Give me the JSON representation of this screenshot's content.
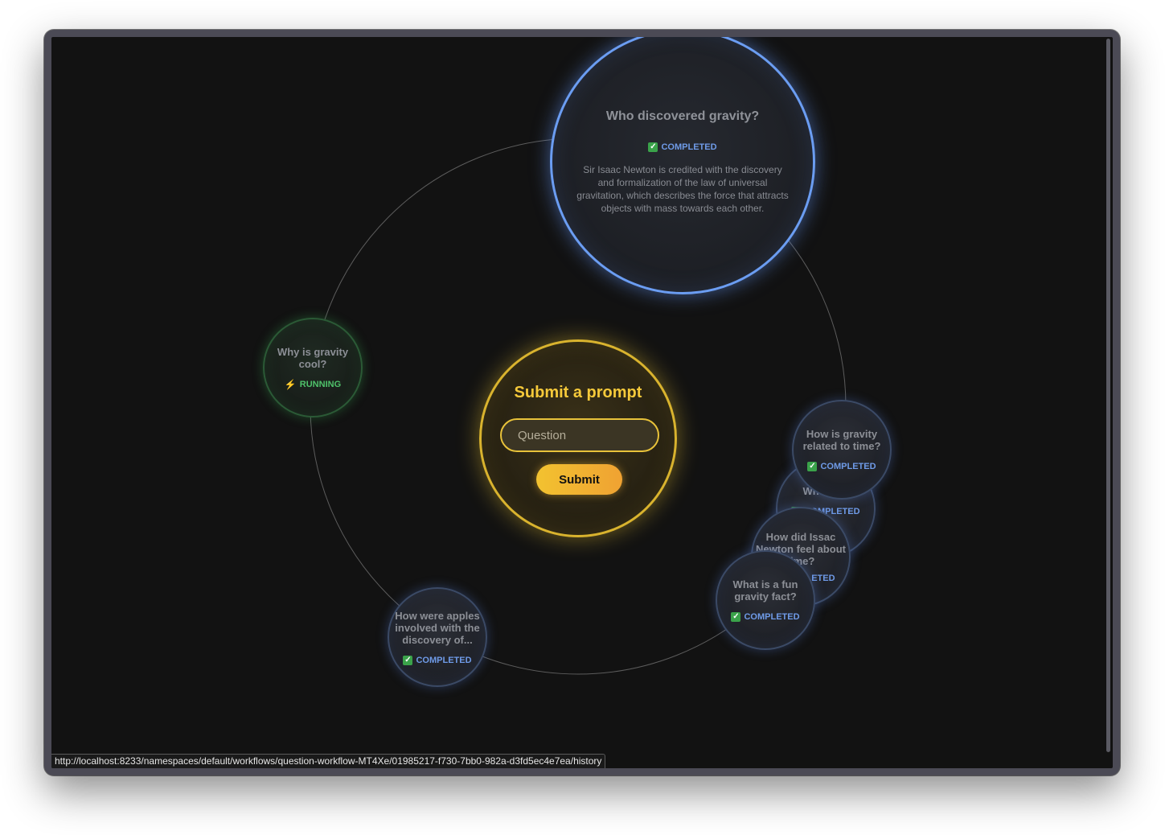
{
  "center": {
    "title": "Submit a prompt",
    "input_placeholder": "Question",
    "input_value": "",
    "submit_label": "Submit"
  },
  "status_labels": {
    "completed": "COMPLETED",
    "running": "RUNNING"
  },
  "nodes": [
    {
      "title": "Who discovered gravity?",
      "status": "COMPLETED",
      "answer": "Sir Isaac Newton is credited with the discovery and formalization of the law of universal gravitation, which describes the force that attracts objects with mass towards each other."
    },
    {
      "title": "Why is gravity cool?",
      "status": "RUNNING"
    },
    {
      "title": "How is gravity related to time?",
      "status": "COMPLETED"
    },
    {
      "title": "What is...",
      "status": "COMPLETED"
    },
    {
      "title": "How did Issac Newton feel about time?",
      "status": "COMPLETED"
    },
    {
      "title": "What is a fun gravity fact?",
      "status": "COMPLETED"
    },
    {
      "title": "How were apples involved with the discovery of...",
      "status": "COMPLETED"
    }
  ],
  "status_bar": {
    "url": "http://localhost:8233/namespaces/default/workflows/question-workflow-MT4Xe/01985217-f730-7bb0-982a-d3fd5ec4e7ea/history"
  },
  "colors": {
    "background": "#121212",
    "accent_gold": "#f5c93a",
    "completed_blue": "#6f9be8",
    "running_green": "#4fc26a"
  },
  "icons": {
    "completed": "check-box-icon",
    "running": "lightning-bolt-icon"
  }
}
